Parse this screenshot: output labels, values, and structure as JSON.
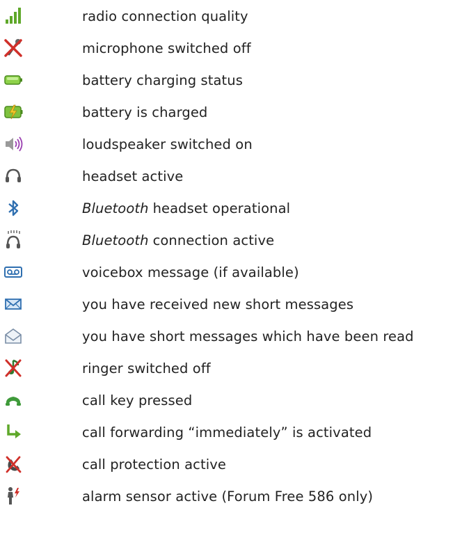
{
  "legend": {
    "items": [
      {
        "icon": "signal-strength-icon",
        "label": "radio connection quality"
      },
      {
        "icon": "microphone-off-icon",
        "label": "microphone switched off"
      },
      {
        "icon": "battery-charging-icon",
        "label": "battery charging status"
      },
      {
        "icon": "battery-charged-icon",
        "label": "battery is charged"
      },
      {
        "icon": "loudspeaker-on-icon",
        "label": "loudspeaker switched on"
      },
      {
        "icon": "headset-icon",
        "label": "headset active"
      },
      {
        "icon": "bluetooth-icon",
        "emphasis": "Bluetooth",
        "label": "headset operational"
      },
      {
        "icon": "bluetooth-connection-icon",
        "emphasis": "Bluetooth",
        "label": "connection active"
      },
      {
        "icon": "voicebox-icon",
        "label": "voicebox message (if available)"
      },
      {
        "icon": "envelope-new-icon",
        "label": "you have received new short messages"
      },
      {
        "icon": "envelope-read-icon",
        "label": "you have short messages which have been read"
      },
      {
        "icon": "ringer-off-icon",
        "label": "ringer switched off"
      },
      {
        "icon": "call-key-icon",
        "label": "call key pressed"
      },
      {
        "icon": "call-forward-icon",
        "label": "call forwarding “immediately” is activated"
      },
      {
        "icon": "call-protection-icon",
        "label": "call protection active"
      },
      {
        "icon": "alarm-sensor-icon",
        "label": "alarm sensor active (Forum Free 586 only)"
      }
    ]
  },
  "colors": {
    "green": "#5fa82a",
    "red": "#d0302a",
    "blue": "#2f6fb0",
    "gray": "#707070",
    "text": "#222222"
  }
}
